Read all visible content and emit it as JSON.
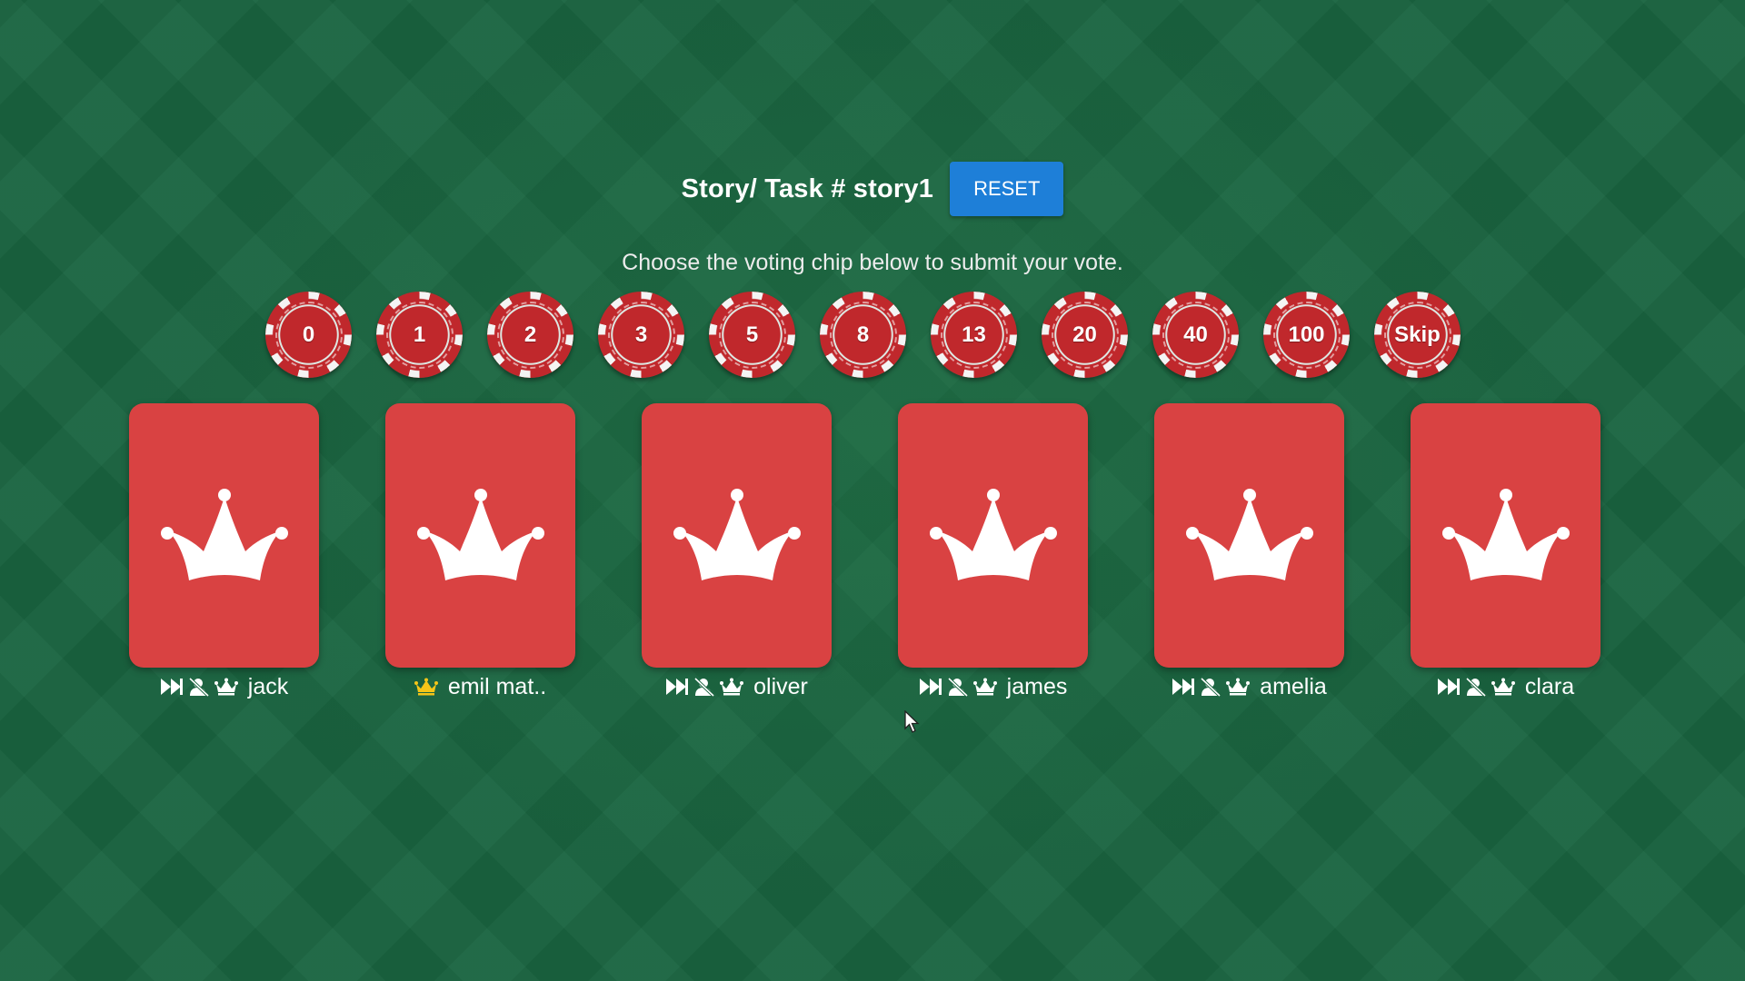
{
  "header": {
    "story_label": "Story/ Task # story1",
    "reset_label": "RESET"
  },
  "instruction": "Choose the voting chip below to submit your vote.",
  "chips": [
    "0",
    "1",
    "2",
    "3",
    "5",
    "8",
    "13",
    "20",
    "40",
    "100",
    "Skip"
  ],
  "players": [
    {
      "name": "jack",
      "is_moderator": false
    },
    {
      "name": "emil mat..",
      "is_moderator": true
    },
    {
      "name": "oliver",
      "is_moderator": false
    },
    {
      "name": "james",
      "is_moderator": false
    },
    {
      "name": "amelia",
      "is_moderator": false
    },
    {
      "name": "clara",
      "is_moderator": false
    }
  ],
  "icons": {
    "card_face": "jester-crown-icon",
    "skip": "fast-forward-icon",
    "remove_user": "remove-user-icon",
    "make_moderator": "crown-icon",
    "moderator_badge": "crown-icon"
  },
  "colors": {
    "table_felt": "#1a6440",
    "card": "#d94242",
    "chip": "#c0282c",
    "reset_button": "#1e7fd8",
    "moderator_crown": "#f5c518"
  }
}
